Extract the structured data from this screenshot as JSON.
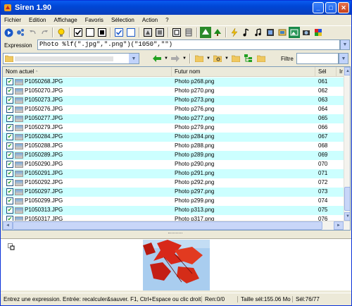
{
  "window": {
    "title": "Siren 1.90"
  },
  "menu": [
    "Fichier",
    "Edition",
    "Affichage",
    "Favoris",
    "Sélection",
    "Action",
    "?"
  ],
  "expression": {
    "label": "Expression",
    "value": "Photo %lf(\".jpg\",\".png\")(\"1050\",\"\")"
  },
  "filter": {
    "label": "Filtre"
  },
  "columns": {
    "name": "Nom actuel",
    "new": "Futur nom",
    "sel": "Sél",
    "extra": "Ir"
  },
  "rows": [
    {
      "name": "P1050268.JPG",
      "new": "Photo p268.png",
      "sel": "061"
    },
    {
      "name": "P1050270.JPG",
      "new": "Photo p270.png",
      "sel": "062"
    },
    {
      "name": "P1050273.JPG",
      "new": "Photo p273.png",
      "sel": "063"
    },
    {
      "name": "P1050276.JPG",
      "new": "Photo p276.png",
      "sel": "064"
    },
    {
      "name": "P1050277.JPG",
      "new": "Photo p277.png",
      "sel": "065"
    },
    {
      "name": "P1050279.JPG",
      "new": "Photo p279.png",
      "sel": "066"
    },
    {
      "name": "P1050284.JPG",
      "new": "Photo p284.png",
      "sel": "067"
    },
    {
      "name": "P1050288.JPG",
      "new": "Photo p288.png",
      "sel": "068"
    },
    {
      "name": "P1050289.JPG",
      "new": "Photo p289.png",
      "sel": "069"
    },
    {
      "name": "P1050290.JPG",
      "new": "Photo p290.png",
      "sel": "070"
    },
    {
      "name": "P1050291.JPG",
      "new": "Photo p291.png",
      "sel": "071"
    },
    {
      "name": "P1050292.JPG",
      "new": "Photo p292.png",
      "sel": "072"
    },
    {
      "name": "P1050297.JPG",
      "new": "Photo p297.png",
      "sel": "073"
    },
    {
      "name": "P1050299.JPG",
      "new": "Photo p299.png",
      "sel": "074"
    },
    {
      "name": "P1050313.JPG",
      "new": "Photo p313.png",
      "sel": "075"
    },
    {
      "name": "P1050317.JPG",
      "new": "Photo p317.png",
      "sel": "076"
    }
  ],
  "status": {
    "hint": "Entrez une expression. Entrée: recalculer&sauver. F1, Ctrl+Espace ou clic droit:",
    "ren": "Ren:0/0",
    "size": "Taille sél:155.06 Mo",
    "sel": "Sél:76/77"
  },
  "colors": {
    "title": "#0a4ee0",
    "row_alt": "#ccffff",
    "check": "#21a121"
  }
}
